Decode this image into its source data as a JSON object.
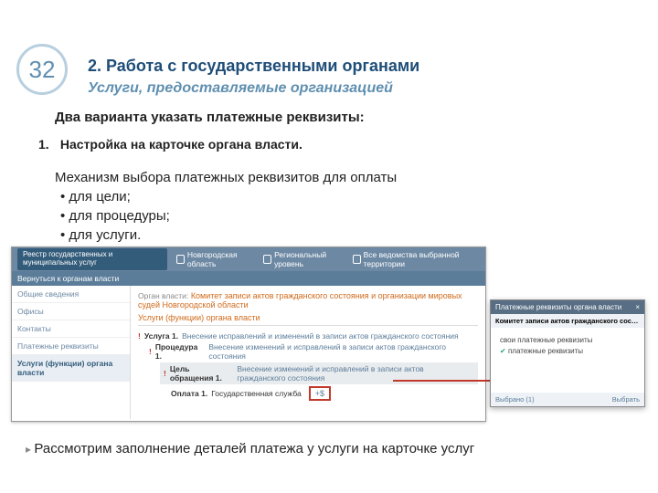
{
  "page_number": "32",
  "section_title": "2. Работа с государственными органами",
  "section_subtitle": "Услуги, предоставляемые организацией",
  "intro": "Два варианта указать платежные реквизиты:",
  "numbered": {
    "num": "1.",
    "text": "Настройка на карточке органа власти."
  },
  "mechanism": {
    "lead": "Механизм выбора платежных реквизитов для оплаты",
    "items": [
      "для цели;",
      "для процедуры;",
      "для услуги."
    ]
  },
  "shot": {
    "logo": "Реестр государственных и муниципальных услуг",
    "top_items": [
      "Новгородская область",
      "Региональный уровень",
      "Все ведомства выбранной территории"
    ],
    "back": "Вернуться к органам власти",
    "side_items": [
      "Общие сведения",
      "Офисы",
      "Контакты",
      "Платежные реквизиты",
      "Услуги (функции) органа власти"
    ],
    "side_active_index": 4,
    "org_label": "Орган власти:",
    "org_name": "Комитет записи актов гражданского состояния и организации мировых судей Новгородской области",
    "tab": "Услуги (функции) органа власти",
    "rows": {
      "service": {
        "label": "Услуга 1.",
        "text": "Внесение исправлений и изменений в записи актов гражданского состояния"
      },
      "procedure": {
        "label": "Процедура 1.",
        "text": "Внесение изменений и исправлений в записи актов гражданского состояния"
      },
      "goal": {
        "label": "Цель обращения 1.",
        "text": "Внесение изменений и исправлений в записи актов гражданского состояния"
      },
      "payment": {
        "label": "Оплата 1.",
        "text": "Государственная служба",
        "btn": "+$"
      }
    }
  },
  "popup": {
    "title": "Платежные реквизиты органа власти",
    "close": "×",
    "subtitle": "Комитет записи актов гражданского состояния и организаци…",
    "options": [
      "свои платежные реквизиты",
      "платежные реквизиты"
    ],
    "checked_index": 1,
    "foot_left": "Выбрано (1)",
    "foot_right": "Выбрать"
  },
  "footnote": "Рассмотрим заполнение деталей платежа у услуги на карточке услуг"
}
